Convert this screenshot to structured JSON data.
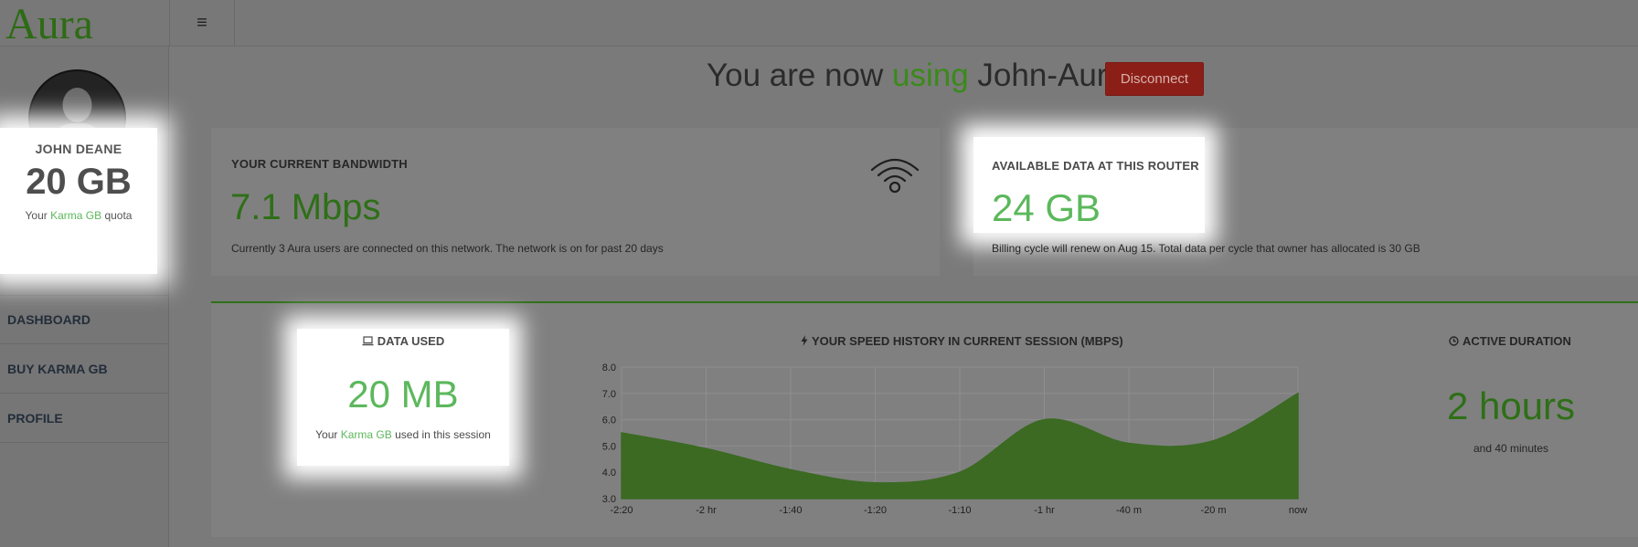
{
  "app": {
    "brand": "Aura",
    "menu_icon": "hamburger-icon",
    "menu_glyph": "≡"
  },
  "user": {
    "name": "JOHN DEANE",
    "quota": "20 GB",
    "quota_note_prefix": "Your ",
    "quota_note_link": "Karma GB",
    "quota_note_suffix": " quota",
    "avatar_icon": "user-silhouette-icon"
  },
  "nav": {
    "items": [
      {
        "label": "DASHBOARD"
      },
      {
        "label": "BUY KARMA GB"
      },
      {
        "label": "PROFILE"
      }
    ]
  },
  "header": {
    "prefix": "You are now ",
    "highlight": "using",
    "suffix": " John-Aura",
    "disconnect_label": "Disconnect"
  },
  "bandwidth": {
    "title": "YOUR CURRENT BANDWIDTH",
    "value": "7.1 Mbps",
    "note": "Currently 3 Aura users are connected on this network. The network is on for past 20 days",
    "icon": "wifi-icon"
  },
  "available": {
    "title": "AVAILABLE DATA AT THIS ROUTER",
    "value": "24 GB",
    "note": "Billing cycle will renew on Aug 15. Total data per cycle that owner has allocated is 30 GB"
  },
  "data_used": {
    "title": "DATA USED",
    "icon": "laptop-icon",
    "value": "20 MB",
    "note_prefix": "Your ",
    "note_link": "Karma GB",
    "note_suffix": " used in this session"
  },
  "speed": {
    "title": "YOUR SPEED HISTORY IN CURRENT SESSION (MBPS)",
    "icon": "bolt-icon"
  },
  "duration": {
    "title": "ACTIVE DURATION",
    "icon": "clock-icon",
    "value": "2 hours",
    "note": "and 40 minutes"
  },
  "colors": {
    "accent": "#5cb85c",
    "accent_dim": "#2e6f17",
    "danger": "#8b1f17",
    "area_fill": "#3d6a23"
  },
  "chart_data": {
    "type": "area",
    "title": "YOUR SPEED HISTORY IN CURRENT SESSION (MBPS)",
    "x_ticks": [
      "-2:20",
      "-2 hr",
      "-1:40",
      "-1:20",
      "-1:10",
      "-1 hr",
      "-40 m",
      "-20 m",
      "now"
    ],
    "y_ticks": [
      "3.0",
      "4.0",
      "5.0",
      "6.0",
      "7.0",
      "8.0"
    ],
    "ylim": [
      3,
      8
    ],
    "series": [
      {
        "values": [
          5.5,
          4.9,
          4.1,
          3.6,
          4.0,
          6.0,
          5.1,
          5.2,
          7.0
        ]
      }
    ],
    "grid": true
  }
}
